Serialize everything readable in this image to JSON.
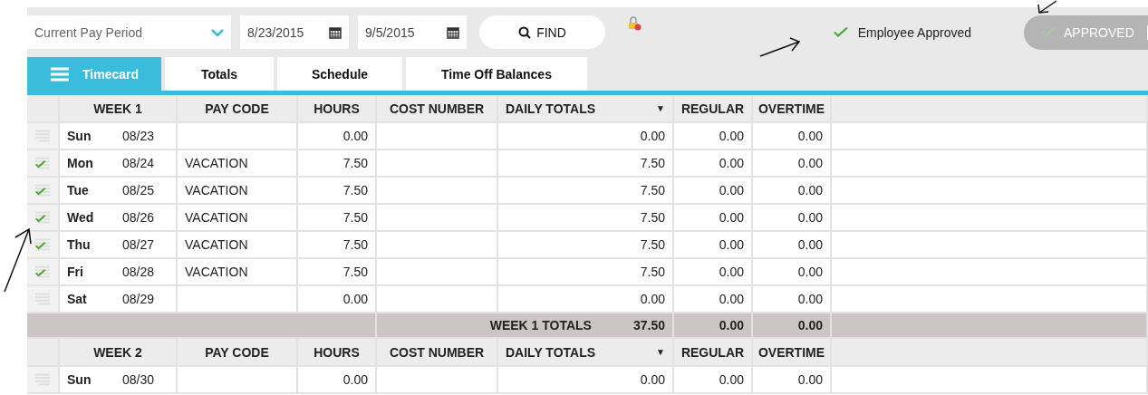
{
  "toolbar": {
    "period": {
      "value": "Current Pay Period"
    },
    "start_date": {
      "value": "8/23/2015"
    },
    "end_date": {
      "value": "9/5/2015"
    },
    "find_button": {
      "label": "FIND"
    },
    "status": {
      "label": "Employee Approved",
      "approved": true
    },
    "approve_button": {
      "label": "APPROVED",
      "disabled": true
    }
  },
  "tabs": [
    {
      "label": "Timecard",
      "selected": true
    },
    {
      "label": "Totals",
      "selected": false
    },
    {
      "label": "Schedule",
      "selected": false
    },
    {
      "label": "Time Off Balances",
      "selected": false
    }
  ],
  "weeks": [
    {
      "columns": [
        "WEEK 1",
        "PAY CODE",
        "HOURS",
        "COST NUMBER",
        "DAILY TOTALS",
        "REGULAR",
        "OVERTIME"
      ],
      "sort_marker": "▼",
      "rows": [
        {
          "day": "Sun",
          "date": "08/23",
          "pay_code": "",
          "hours": "0.00",
          "cost_number": "",
          "daily_total": "0.00",
          "regular": "0.00",
          "overtime": "0.00",
          "approved": false
        },
        {
          "day": "Mon",
          "date": "08/24",
          "pay_code": "VACATION",
          "hours": "7.50",
          "cost_number": "",
          "daily_total": "7.50",
          "regular": "0.00",
          "overtime": "0.00",
          "approved": true
        },
        {
          "day": "Tue",
          "date": "08/25",
          "pay_code": "VACATION",
          "hours": "7.50",
          "cost_number": "",
          "daily_total": "7.50",
          "regular": "0.00",
          "overtime": "0.00",
          "approved": true
        },
        {
          "day": "Wed",
          "date": "08/26",
          "pay_code": "VACATION",
          "hours": "7.50",
          "cost_number": "",
          "daily_total": "7.50",
          "regular": "0.00",
          "overtime": "0.00",
          "approved": true
        },
        {
          "day": "Thu",
          "date": "08/27",
          "pay_code": "VACATION",
          "hours": "7.50",
          "cost_number": "",
          "daily_total": "7.50",
          "regular": "0.00",
          "overtime": "0.00",
          "approved": true
        },
        {
          "day": "Fri",
          "date": "08/28",
          "pay_code": "VACATION",
          "hours": "7.50",
          "cost_number": "",
          "daily_total": "7.50",
          "regular": "0.00",
          "overtime": "0.00",
          "approved": true
        },
        {
          "day": "Sat",
          "date": "08/29",
          "pay_code": "",
          "hours": "0.00",
          "cost_number": "",
          "daily_total": "0.00",
          "regular": "0.00",
          "overtime": "0.00",
          "approved": false
        }
      ],
      "totals": {
        "label": "WEEK 1 TOTALS",
        "daily_total": "37.50",
        "regular": "0.00",
        "overtime": "0.00"
      }
    },
    {
      "columns": [
        "WEEK 2",
        "PAY CODE",
        "HOURS",
        "COST NUMBER",
        "DAILY TOTALS",
        "REGULAR",
        "OVERTIME"
      ],
      "sort_marker": "▼",
      "rows": [
        {
          "day": "Sun",
          "date": "08/30",
          "pay_code": "",
          "hours": "0.00",
          "cost_number": "",
          "daily_total": "0.00",
          "regular": "0.00",
          "overtime": "0.00",
          "approved": false
        }
      ]
    }
  ]
}
